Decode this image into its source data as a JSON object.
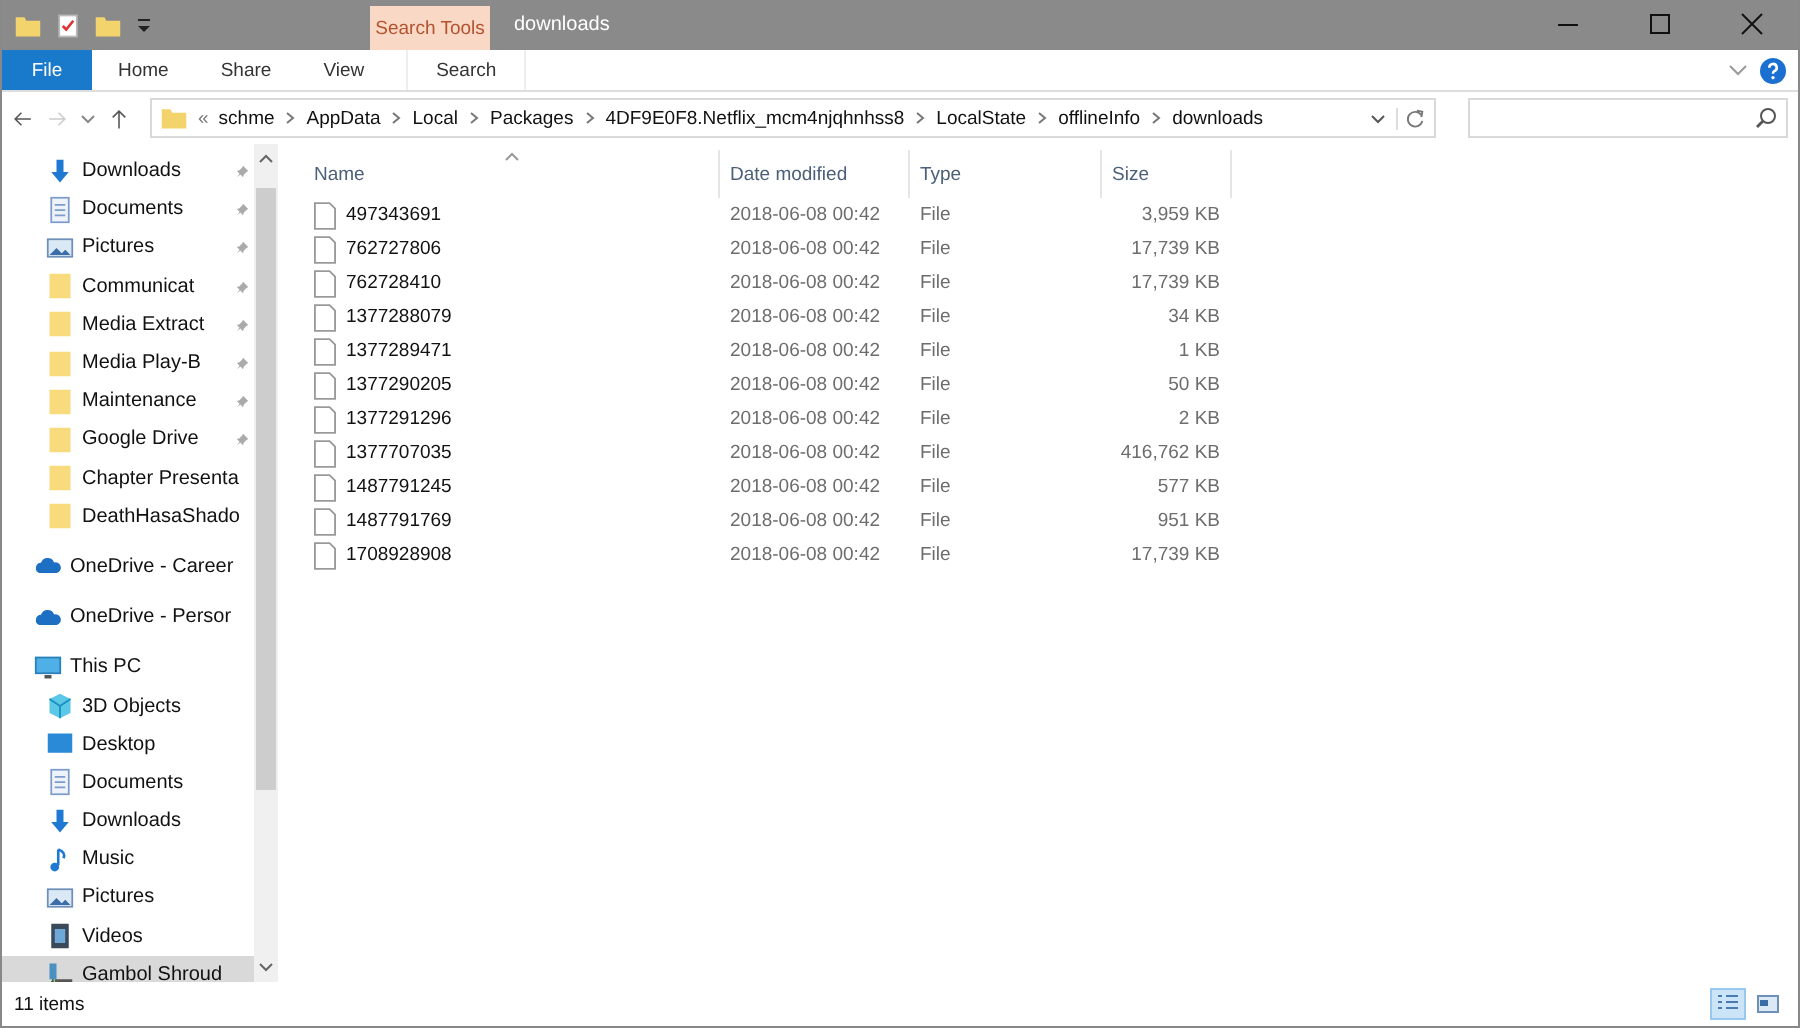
{
  "window": {
    "title": "downloads",
    "context_tab": "Search Tools"
  },
  "ribbon_tabs": [
    {
      "label": "File",
      "kind": "file",
      "selected": false
    },
    {
      "label": "Home",
      "kind": "tab",
      "selected": false
    },
    {
      "label": "Share",
      "kind": "tab",
      "selected": false
    },
    {
      "label": "View",
      "kind": "tab",
      "selected": false
    },
    {
      "label": "Search",
      "kind": "context",
      "selected": false
    }
  ],
  "address": {
    "prefix": "«",
    "crumbs": [
      "schme",
      "AppData",
      "Local",
      "Packages",
      "4DF9E0F8.Netflix_mcm4njqhnhss8",
      "LocalState",
      "offlineInfo",
      "downloads"
    ]
  },
  "sidebar": {
    "quick_access": [
      {
        "label": "Downloads",
        "kind": "download",
        "pinned": true,
        "selected": false
      },
      {
        "label": "Documents",
        "kind": "document",
        "pinned": true,
        "selected": false
      },
      {
        "label": "Pictures",
        "kind": "picture",
        "pinned": true,
        "selected": false
      },
      {
        "label": "Communicat",
        "kind": "folder",
        "pinned": true,
        "selected": false
      },
      {
        "label": "Media Extract",
        "kind": "folder",
        "pinned": true,
        "selected": false
      },
      {
        "label": "Media Play-B",
        "kind": "folder",
        "pinned": true,
        "selected": false
      },
      {
        "label": "Maintenance",
        "kind": "folder",
        "pinned": true,
        "selected": false
      },
      {
        "label": "Google Drive",
        "kind": "folder",
        "pinned": true,
        "selected": false
      },
      {
        "label": "Chapter Presenta",
        "kind": "folder",
        "pinned": false,
        "selected": false
      },
      {
        "label": "DeathHasaShado",
        "kind": "folder",
        "pinned": false,
        "selected": false
      }
    ],
    "locations": [
      {
        "label": "OneDrive - Career",
        "kind": "cloud",
        "selected": false
      },
      {
        "label": "OneDrive - Persor",
        "kind": "cloud",
        "selected": false
      },
      {
        "label": "This PC",
        "kind": "pc",
        "selected": false,
        "children": [
          {
            "label": "3D Objects",
            "kind": "cube",
            "selected": false
          },
          {
            "label": "Desktop",
            "kind": "desktop",
            "selected": false
          },
          {
            "label": "Documents",
            "kind": "document",
            "selected": false
          },
          {
            "label": "Downloads",
            "kind": "download",
            "selected": false
          },
          {
            "label": "Music",
            "kind": "music",
            "selected": false
          },
          {
            "label": "Pictures",
            "kind": "picture",
            "selected": false
          },
          {
            "label": "Videos",
            "kind": "video",
            "selected": false
          },
          {
            "label": "Gambol Shroud",
            "kind": "network",
            "selected": true
          }
        ]
      }
    ]
  },
  "table": {
    "columns": [
      "Name",
      "Date modified",
      "Type",
      "Size"
    ],
    "rows": [
      {
        "name": "497343691",
        "date": "2018-06-08 00:42",
        "type": "File",
        "size": "3,959 KB"
      },
      {
        "name": "762727806",
        "date": "2018-06-08 00:42",
        "type": "File",
        "size": "17,739 KB"
      },
      {
        "name": "762728410",
        "date": "2018-06-08 00:42",
        "type": "File",
        "size": "17,739 KB"
      },
      {
        "name": "1377288079",
        "date": "2018-06-08 00:42",
        "type": "File",
        "size": "34 KB"
      },
      {
        "name": "1377289471",
        "date": "2018-06-08 00:42",
        "type": "File",
        "size": "1 KB"
      },
      {
        "name": "1377290205",
        "date": "2018-06-08 00:42",
        "type": "File",
        "size": "50 KB"
      },
      {
        "name": "1377291296",
        "date": "2018-06-08 00:42",
        "type": "File",
        "size": "2 KB"
      },
      {
        "name": "1377707035",
        "date": "2018-06-08 00:42",
        "type": "File",
        "size": "416,762 KB"
      },
      {
        "name": "1487791245",
        "date": "2018-06-08 00:42",
        "type": "File",
        "size": "577 KB"
      },
      {
        "name": "1487791769",
        "date": "2018-06-08 00:42",
        "type": "File",
        "size": "951 KB"
      },
      {
        "name": "1708928908",
        "date": "2018-06-08 00:42",
        "type": "File",
        "size": "17,739 KB"
      }
    ]
  },
  "status_bar": {
    "count": "11 items"
  },
  "view_buttons": [
    {
      "kind": "details",
      "selected": true
    },
    {
      "kind": "tiles",
      "selected": false
    }
  ]
}
